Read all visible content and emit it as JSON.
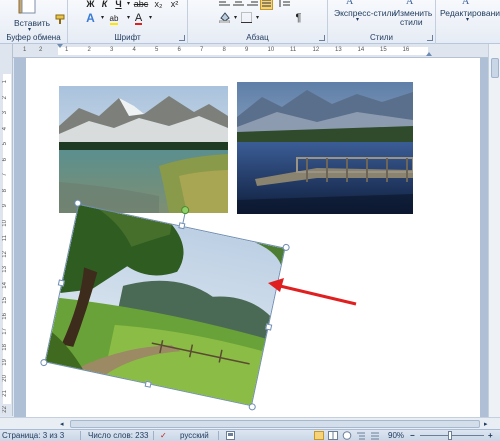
{
  "ribbon": {
    "clipboard": {
      "paste_label": "Вставить",
      "group_label": "Буфер обмена"
    },
    "font": {
      "group_label": "Шрифт",
      "bold": "Ж",
      "italic": "К",
      "underline": "Ч",
      "strikethrough": "abc",
      "subscript": "x₂",
      "superscript": "x²",
      "font_color_letter": "A",
      "text_effects_letter": "A",
      "highlight_letter": "ab"
    },
    "paragraph": {
      "group_label": "Абзац",
      "pilcrow": "¶"
    },
    "styles": {
      "group_label": "Стили",
      "express_styles_label": "Экспресс-стили",
      "change_styles_label": "Изменить",
      "change_styles_label2": "стили"
    },
    "editing": {
      "label": "Редактирование"
    }
  },
  "ruler": {
    "h_numbers": [
      "1",
      "2",
      "1",
      "2",
      "3",
      "4",
      "5",
      "6",
      "7",
      "8",
      "9",
      "10",
      "11",
      "12",
      "13",
      "14",
      "15",
      "16"
    ],
    "v_numbers": [
      "1",
      "2",
      "3",
      "4",
      "5",
      "6",
      "7",
      "8",
      "9",
      "10",
      "11",
      "12",
      "13",
      "14",
      "15",
      "16",
      "17",
      "18",
      "19",
      "20",
      "21",
      "22"
    ]
  },
  "status_bar": {
    "page": "Страница: 3 из 3",
    "words": "Число слов: 233",
    "language": "русский",
    "zoom": "90%",
    "zoom_minus": "−",
    "zoom_plus": "+"
  },
  "colors": {
    "arrow": "#e02020",
    "selection": "#6f8db3",
    "ribbon_bg": "#e6ecf5",
    "doc_bg": "#aebfd6"
  }
}
